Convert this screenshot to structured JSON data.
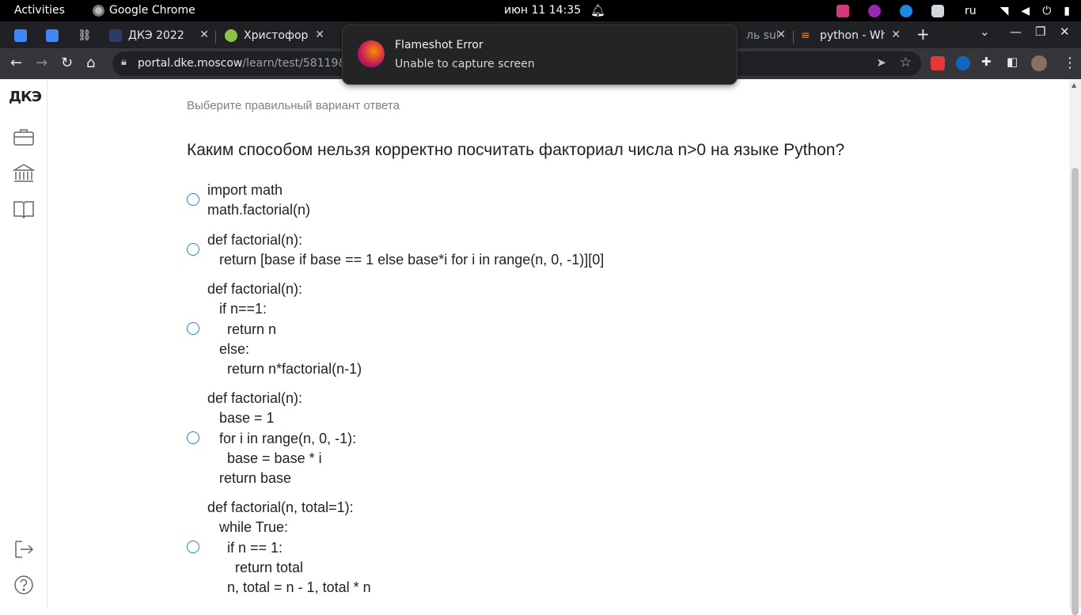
{
  "system_bar": {
    "activities": "Activities",
    "app_name": "Google Chrome",
    "clock": "июн 11  14:35",
    "language": "ru"
  },
  "tabs": [
    {
      "title": "",
      "color": "#4285f4"
    },
    {
      "title": "",
      "color": "#4285f4"
    },
    {
      "title": "",
      "color": "#e8eaed"
    },
    {
      "title": "ДКЭ 2022",
      "color": "#2b3d63"
    },
    {
      "title": "Христофор",
      "color": "#8bc34a"
    },
    {
      "title": "ль sub",
      "color": "#555555"
    },
    {
      "title": "python - Wh",
      "color": "#f48024"
    }
  ],
  "address_bar": {
    "url_host": "portal.dke.moscow",
    "url_path": "/learn/test/58119&exe"
  },
  "notification": {
    "title": "Flameshot Error",
    "message": "Unable to capture screen"
  },
  "sidebar": {
    "brand": "ДКЭ"
  },
  "quiz": {
    "hint": "Выберите правильный вариант ответа",
    "question": "Каким способом нельзя корректно посчитать факториал числа n>0 на языке Python?",
    "options": [
      "import math\nmath.factorial(n)",
      "def factorial(n):\n   return [base if base == 1 else base*i for i in range(n, 0, -1)][0]",
      "def factorial(n):\n   if n==1:\n     return n\n   else:\n     return n*factorial(n-1)",
      "def factorial(n):\n   base = 1\n   for i in range(n, 0, -1):\n     base = base * i\n   return base",
      "def factorial(n, total=1):\n   while True:\n     if n == 1:\n       return total\n     n, total = n - 1, total * n"
    ]
  },
  "colors": {
    "radio_border": "#1b8ab8",
    "chrome_dark": "#202124",
    "toolbar": "#35363a"
  }
}
